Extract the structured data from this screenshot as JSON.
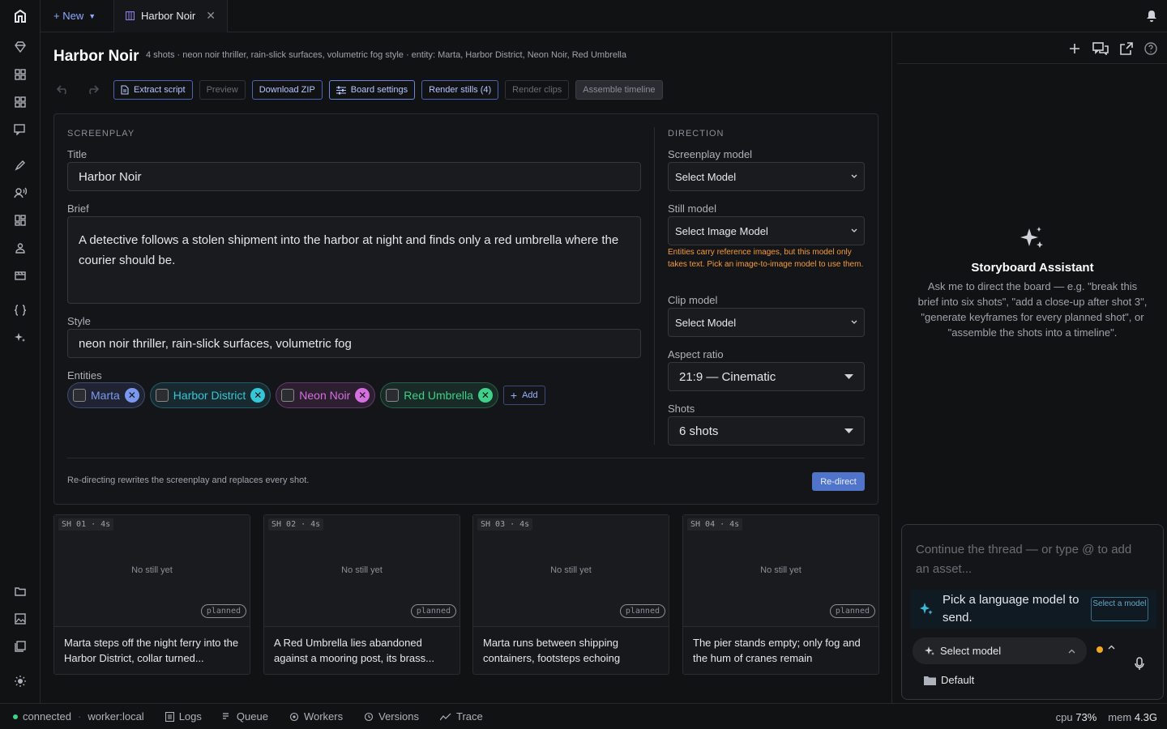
{
  "topbar": {
    "new_label": "+ New",
    "tab_title": "Harbor Noir"
  },
  "page": {
    "title": "Harbor Noir",
    "subtitle": "4 shots · neon noir thriller, rain-slick surfaces, volumetric fog style · entity: Marta, Harbor District, Neon Noir, Red Umbrella"
  },
  "toolbar": {
    "extract": "Extract script",
    "preview": "Preview",
    "download": "Download ZIP",
    "board_settings": "Board settings",
    "render_stills": "Render stills (4)",
    "render_clips": "Render clips",
    "assemble": "Assemble timeline"
  },
  "screenplay": {
    "section": "SCREENPLAY",
    "title_label": "Title",
    "title_value": "Harbor Noir",
    "brief_label": "Brief",
    "brief_value": "A detective follows a stolen shipment into the harbor at night and finds only a red umbrella where the courier should be.",
    "style_label": "Style",
    "style_value": "neon noir thriller, rain-slick surfaces, volumetric fog",
    "entities_label": "Entities",
    "entities": [
      {
        "name": "Marta",
        "color": "#7a98f0"
      },
      {
        "name": "Harbor District",
        "color": "#36c6d8"
      },
      {
        "name": "Neon Noir",
        "color": "#d66fe0"
      },
      {
        "name": "Red Umbrella",
        "color": "#3fd08a"
      }
    ],
    "add_label": "Add"
  },
  "direction": {
    "section": "DIRECTION",
    "screenplay_model_label": "Screenplay model",
    "screenplay_model_value": "Select Model",
    "still_model_label": "Still model",
    "still_model_value": "Select Image Model",
    "warning": "Entities carry reference images, but this model only takes text. Pick an image-to-image model to use them.",
    "clip_model_label": "Clip model",
    "clip_model_value": "Select Model",
    "aspect_label": "Aspect ratio",
    "aspect_value": "21:9 — Cinematic",
    "shots_label": "Shots",
    "shots_value": "6 shots"
  },
  "footer": {
    "note": "Re-directing rewrites the screenplay and replaces every shot.",
    "redirect": "Re-direct"
  },
  "shots": [
    {
      "tag": "SH 01 · 4s",
      "placeholder": "No still yet",
      "status": "planned",
      "caption": "Marta steps off the night ferry into the Harbor District, collar turned..."
    },
    {
      "tag": "SH 02 · 4s",
      "placeholder": "No still yet",
      "status": "planned",
      "caption": "A Red Umbrella lies abandoned against a mooring post, its brass..."
    },
    {
      "tag": "SH 03 · 4s",
      "placeholder": "No still yet",
      "status": "planned",
      "caption": "Marta runs between shipping containers, footsteps echoing"
    },
    {
      "tag": "SH 04 · 4s",
      "placeholder": "No still yet",
      "status": "planned",
      "caption": "The pier stands empty; only fog and the hum of cranes remain"
    }
  ],
  "assistant": {
    "title": "Storyboard Assistant",
    "desc": "Ask me to direct the board — e.g. \"break this brief into six shots\", \"add a close-up after shot 3\", \"generate keyframes for every planned shot\", or \"assemble the shots into a timeline\".",
    "placeholder": "Continue the thread — or type @ to add an asset...",
    "pick_text": "Pick a language model to send.",
    "select_btn": "Select a model",
    "model_select": "Select model",
    "folder": "Default"
  },
  "status": {
    "connected": "connected",
    "worker": "worker:local",
    "logs": "Logs",
    "queue": "Queue",
    "workers": "Workers",
    "versions": "Versions",
    "trace": "Trace",
    "cpu_label": "cpu",
    "cpu_value": "73%",
    "mem_label": "mem",
    "mem_value": "4.3G"
  }
}
